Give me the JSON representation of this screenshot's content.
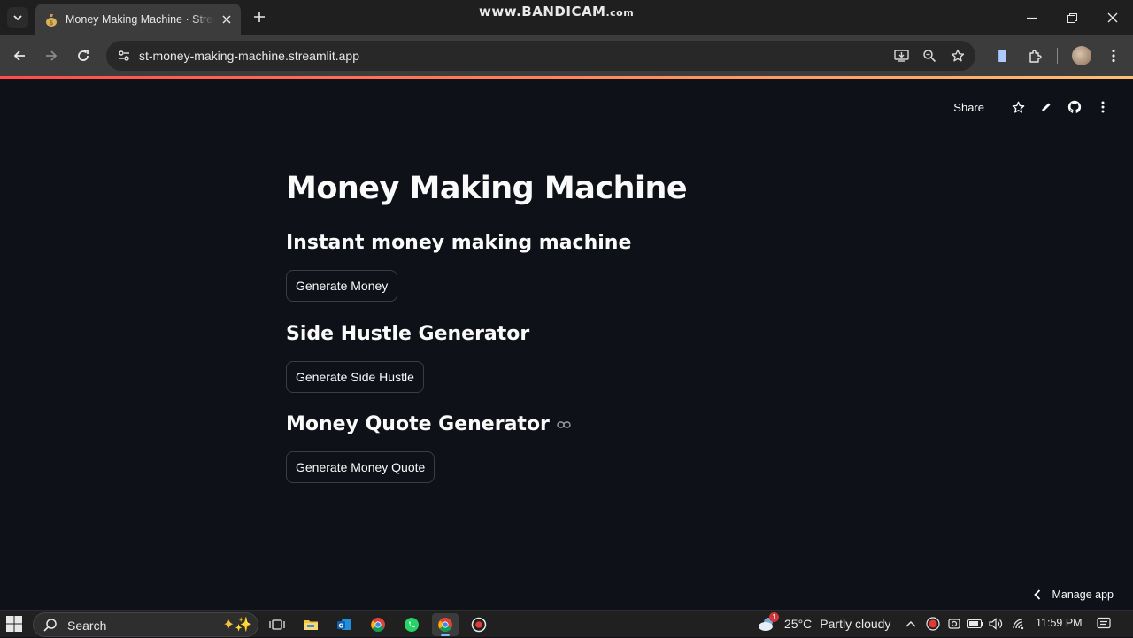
{
  "browser": {
    "tab_title": "Money Making Machine · Streamlit",
    "tab_favicon": "money-bag-icon",
    "url": "st-money-making-machine.streamlit.app",
    "watermark_main": "www.BANDICAM",
    "watermark_suffix": ".com"
  },
  "app": {
    "header": {
      "share_label": "Share"
    },
    "title": "Money Making Machine",
    "sections": [
      {
        "heading": "Instant money making machine",
        "button": "Generate Money"
      },
      {
        "heading": "Side Hustle Generator",
        "button": "Generate Side Hustle"
      },
      {
        "heading": "Money Quote Generator",
        "button": "Generate Money Quote"
      }
    ],
    "manage_app": "Manage app",
    "colors": {
      "background": "#0e1117",
      "text": "#fafafa",
      "decoration_start": "#ff4b4b",
      "decoration_end": "#fdbf6f"
    }
  },
  "taskbar": {
    "search_placeholder": "Search",
    "weather_temp": "25°C",
    "weather_condition": "Partly cloudy",
    "weather_badge": "1",
    "time": "11:59 PM"
  }
}
